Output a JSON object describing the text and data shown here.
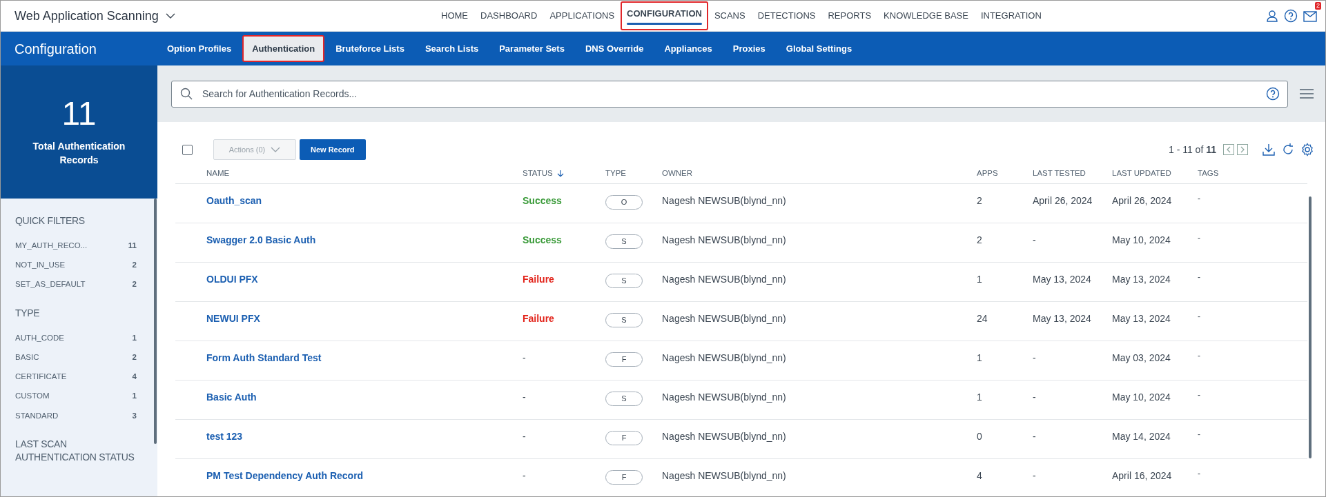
{
  "app": {
    "title": "Web Application Scanning"
  },
  "main_nav": [
    {
      "label": "HOME",
      "selected": false,
      "highlighted": false
    },
    {
      "label": "DASHBOARD",
      "selected": false,
      "highlighted": false
    },
    {
      "label": "APPLICATIONS",
      "selected": false,
      "highlighted": false
    },
    {
      "label": "CONFIGURATION",
      "selected": true,
      "highlighted": true
    },
    {
      "label": "SCANS",
      "selected": false,
      "highlighted": false
    },
    {
      "label": "DETECTIONS",
      "selected": false,
      "highlighted": false
    },
    {
      "label": "REPORTS",
      "selected": false,
      "highlighted": false
    },
    {
      "label": "KNOWLEDGE BASE",
      "selected": false,
      "highlighted": false
    },
    {
      "label": "INTEGRATION",
      "selected": false,
      "highlighted": false
    }
  ],
  "mail_badge": "2",
  "section_title": "Configuration",
  "sub_tabs": [
    {
      "label": "Option Profiles",
      "selected": false,
      "highlighted": false
    },
    {
      "label": "Authentication",
      "selected": true,
      "highlighted": true
    },
    {
      "label": "Bruteforce Lists",
      "selected": false,
      "highlighted": false
    },
    {
      "label": "Search Lists",
      "selected": false,
      "highlighted": false
    },
    {
      "label": "Parameter Sets",
      "selected": false,
      "highlighted": false
    },
    {
      "label": "DNS Override",
      "selected": false,
      "highlighted": false
    },
    {
      "label": "Appliances",
      "selected": false,
      "highlighted": false
    },
    {
      "label": "Proxies",
      "selected": false,
      "highlighted": false
    },
    {
      "label": "Global Settings",
      "selected": false,
      "highlighted": false
    }
  ],
  "summary": {
    "count": "11",
    "label": "Total Authentication Records"
  },
  "filter_groups": [
    {
      "title": "QUICK FILTERS",
      "items": [
        {
          "label": "MY_AUTH_RECO...",
          "count": "11"
        },
        {
          "label": "NOT_IN_USE",
          "count": "2"
        },
        {
          "label": "SET_AS_DEFAULT",
          "count": "2"
        }
      ]
    },
    {
      "title": "TYPE",
      "items": [
        {
          "label": "AUTH_CODE",
          "count": "1"
        },
        {
          "label": "BASIC",
          "count": "2"
        },
        {
          "label": "CERTIFICATE",
          "count": "4"
        },
        {
          "label": "CUSTOM",
          "count": "1"
        },
        {
          "label": "STANDARD",
          "count": "3"
        }
      ]
    },
    {
      "title": "LAST SCAN AUTHENTICATION STATUS"
    }
  ],
  "search": {
    "placeholder": "Search for Authentication Records..."
  },
  "toolbar": {
    "select_all_checked": false,
    "actions": {
      "label": "Actions (0)",
      "disabled": true
    },
    "new_button": "New Record",
    "range": "1 - 11 of",
    "total": "11"
  },
  "table": {
    "columns": [
      {
        "label": "NAME",
        "sorted": false
      },
      {
        "label": "STATUS",
        "sorted": true
      },
      {
        "label": "TYPE",
        "sorted": false
      },
      {
        "label": "OWNER",
        "sorted": false
      },
      {
        "label": "APPS",
        "sorted": false
      },
      {
        "label": "LAST TESTED",
        "sorted": false
      },
      {
        "label": "LAST UPDATED",
        "sorted": false
      },
      {
        "label": "TAGS",
        "sorted": false
      }
    ],
    "rows": [
      {
        "name": "Oauth_scan",
        "status": "Success",
        "kind": "success",
        "type": "O",
        "owner": "Nagesh NEWSUB(blynd_nn)",
        "apps": "2",
        "last_tested": "April 26, 2024",
        "last_updated": "April 26, 2024",
        "tags": "-"
      },
      {
        "name": "Swagger 2.0 Basic Auth",
        "status": "Success",
        "kind": "success",
        "type": "S",
        "owner": "Nagesh NEWSUB(blynd_nn)",
        "apps": "2",
        "last_tested": "-",
        "last_updated": "May 10, 2024",
        "tags": "-"
      },
      {
        "name": "OLDUI PFX",
        "status": "Failure",
        "kind": "failure",
        "type": "S",
        "owner": "Nagesh NEWSUB(blynd_nn)",
        "apps": "1",
        "last_tested": "May 13, 2024",
        "last_updated": "May 13, 2024",
        "tags": "-"
      },
      {
        "name": "NEWUI PFX",
        "status": "Failure",
        "kind": "failure",
        "type": "S",
        "owner": "Nagesh NEWSUB(blynd_nn)",
        "apps": "24",
        "last_tested": "May 13, 2024",
        "last_updated": "May 13, 2024",
        "tags": "-"
      },
      {
        "name": "Form Auth Standard Test",
        "status": "-",
        "kind": "none",
        "type": "F",
        "owner": "Nagesh NEWSUB(blynd_nn)",
        "apps": "1",
        "last_tested": "-",
        "last_updated": "May 03, 2024",
        "tags": "-"
      },
      {
        "name": "Basic Auth",
        "status": "-",
        "kind": "none",
        "type": "S",
        "owner": "Nagesh NEWSUB(blynd_nn)",
        "apps": "1",
        "last_tested": "-",
        "last_updated": "May 10, 2024",
        "tags": "-"
      },
      {
        "name": "test 123",
        "status": "-",
        "kind": "none",
        "type": "F",
        "owner": "Nagesh NEWSUB(blynd_nn)",
        "apps": "0",
        "last_tested": "-",
        "last_updated": "May 14, 2024",
        "tags": "-"
      },
      {
        "name": "PM Test Dependency Auth Record",
        "status": "-",
        "kind": "none",
        "type": "F",
        "owner": "Nagesh NEWSUB(blynd_nn)",
        "apps": "4",
        "last_tested": "-",
        "last_updated": "April 16, 2024",
        "tags": "-"
      }
    ]
  }
}
